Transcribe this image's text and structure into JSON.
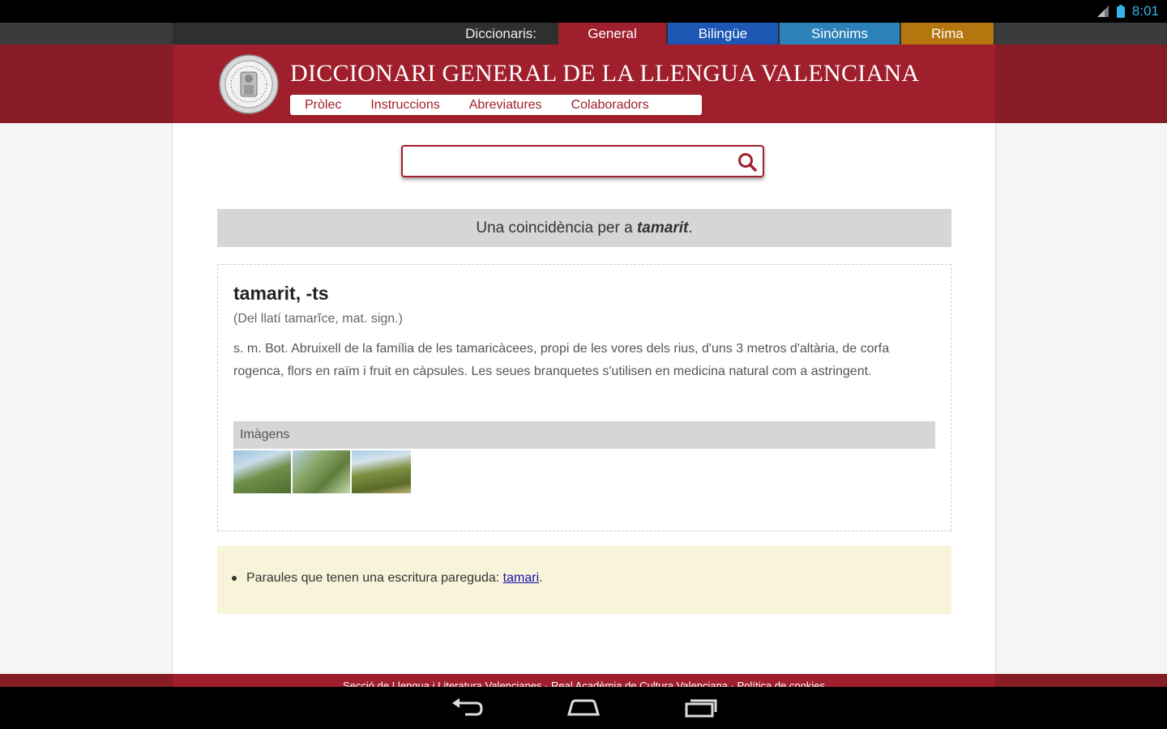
{
  "status": {
    "time": "8:01"
  },
  "dictionaries": {
    "label": "Diccionaris:",
    "tabs": [
      {
        "label": "General",
        "color": "#a01f2c"
      },
      {
        "label": "Bilingüe",
        "color": "#1d57b3"
      },
      {
        "label": "Sinònims",
        "color": "#2c81b8"
      },
      {
        "label": "Rima",
        "color": "#b5760f"
      }
    ]
  },
  "header": {
    "title": "DICCIONARI GENERAL DE LA LLENGUA VALENCIANA",
    "menu": [
      "Pròlec",
      "Instruccions",
      "Abreviatures",
      "Colaboradors"
    ]
  },
  "search": {
    "value": "",
    "placeholder": ""
  },
  "results": {
    "summary_prefix": "Una coincidència per a ",
    "summary_term": "tamarit",
    "summary_suffix": "."
  },
  "entry": {
    "headword": "tamarit, -ts",
    "etymology": "(Del llatí tamarĭce, mat. sign.)",
    "definition": "s. m. Bot. Abruixell de la família de les tamaricàcees, propi de les vores dels rius, d'uns 3 metros d'altària, de corfa rogenca, flors en raïm i fruit en càpsules. Les seues branquetes s'utilisen en medicina natural com a astringent.",
    "images_label": "Imàgens"
  },
  "similar": {
    "text": "Paraules que tenen una escritura pareguda: ",
    "link": "tamari",
    "suffix": "."
  },
  "footer": {
    "text": "Secció de Llengua i Literatura Valencianes · Real Acadèmia de Cultura Valenciana · Política de cookies"
  }
}
